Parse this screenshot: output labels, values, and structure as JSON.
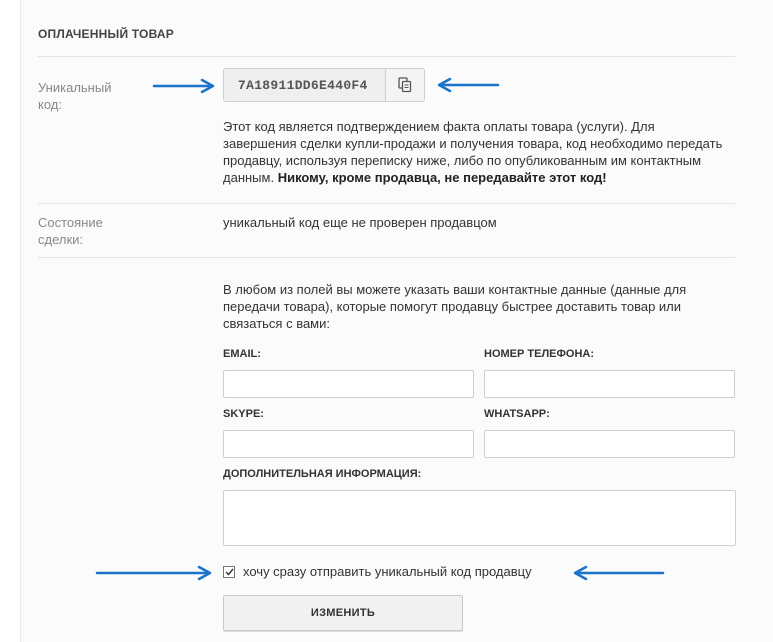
{
  "section": {
    "title": "ОПЛАЧЕННЫЙ ТОВАР"
  },
  "unique_code": {
    "label_line1": "Уникальный",
    "label_line2": "код:",
    "value": "7A18911DD6E440F4",
    "copy_icon": "copy-icon",
    "description": "Этот код является подтверждением факта оплаты товара (услуги). Для завершения сделки купли-продажи и получения товара, код необходимо передать продавцу, используя переписку ниже, либо по опубликованным им контактным данным. ",
    "warning": "Никому, кроме продавца, не передавайте этот код!"
  },
  "deal_status": {
    "label_line1": "Состояние",
    "label_line2": "сделки:",
    "value": "уникальный код еще не проверен продавцом"
  },
  "contacts": {
    "intro": "В любом из полей вы можете указать ваши контактные данные (данные для передачи товара), которые помогут продавцу быстрее доставить товар или связаться с вами:",
    "email_label": "EMAIL:",
    "email_value": "",
    "phone_label": "НОМЕР ТЕЛЕФОНА:",
    "phone_value": "",
    "skype_label": "SKYPE:",
    "skype_value": "",
    "whatsapp_label": "WHATSAPP:",
    "whatsapp_value": "",
    "extra_label": "ДОПОЛНИТЕЛЬНАЯ ИНФОРМАЦИЯ:",
    "extra_value": ""
  },
  "send_code": {
    "checked": true,
    "label": "хочу сразу отправить уникальный код продавцу"
  },
  "submit": {
    "label": "ИЗМЕНИТЬ"
  },
  "colors": {
    "arrow": "#1a73c8",
    "panel_bg": "#fbfbfb",
    "divider": "#e3e3e3"
  }
}
